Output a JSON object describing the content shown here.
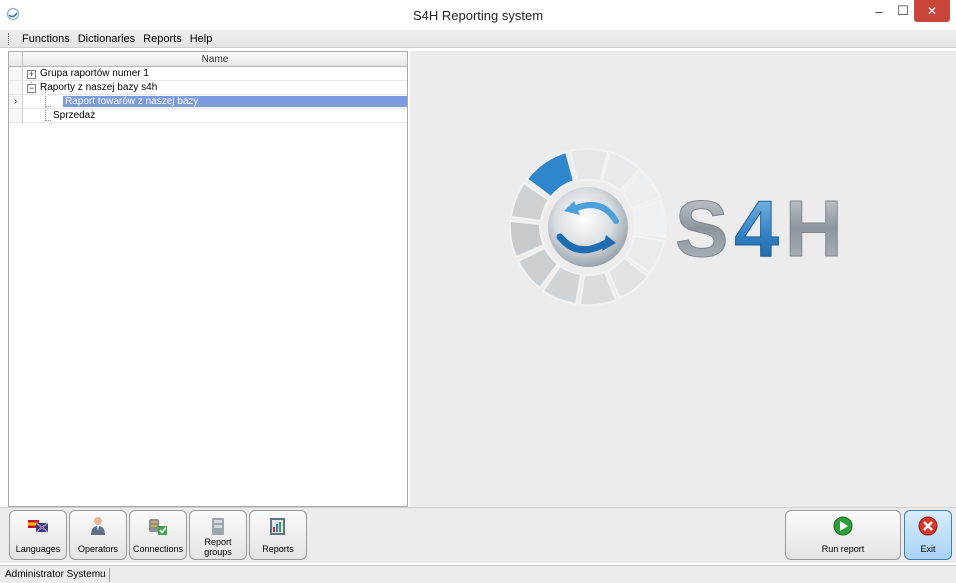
{
  "window": {
    "title": "S4H Reporting system",
    "app_icon": "s4h-app-icon",
    "minimize_glyph": "‒",
    "maximize_glyph": "☐",
    "close_glyph": "✕"
  },
  "menu": {
    "items": [
      "Functions",
      "Dictionaries",
      "Reports",
      "Help"
    ]
  },
  "tree": {
    "column_header": "Name",
    "current_row_marker": "›",
    "rows": [
      {
        "label": "Grupa raportów numer 1",
        "expander": "+"
      },
      {
        "label": "Raporty z naszej bazy s4h",
        "expander": "−"
      },
      {
        "label": "Raport towarów z naszej bazy",
        "selected": true
      },
      {
        "label": "Sprzedaż"
      }
    ]
  },
  "logo": {
    "text": "S4H"
  },
  "toolbar": {
    "buttons": [
      {
        "label": "Languages",
        "icon": "flags-icon"
      },
      {
        "label": "Operators",
        "icon": "operator-icon"
      },
      {
        "label": "Connections",
        "icon": "connections-icon"
      },
      {
        "label": "Report groups",
        "icon": "report-groups-icon"
      },
      {
        "label": "Reports",
        "icon": "reports-icon"
      }
    ],
    "run_report_label": "Run report",
    "exit_label": "Exit"
  },
  "colors": {
    "selection": "#7b9be0",
    "logo_blue": "#2f7fc1",
    "exit_red": "#d9362b",
    "run_green": "#2e9d3a"
  },
  "status": {
    "user": "Administrator Systemu"
  }
}
